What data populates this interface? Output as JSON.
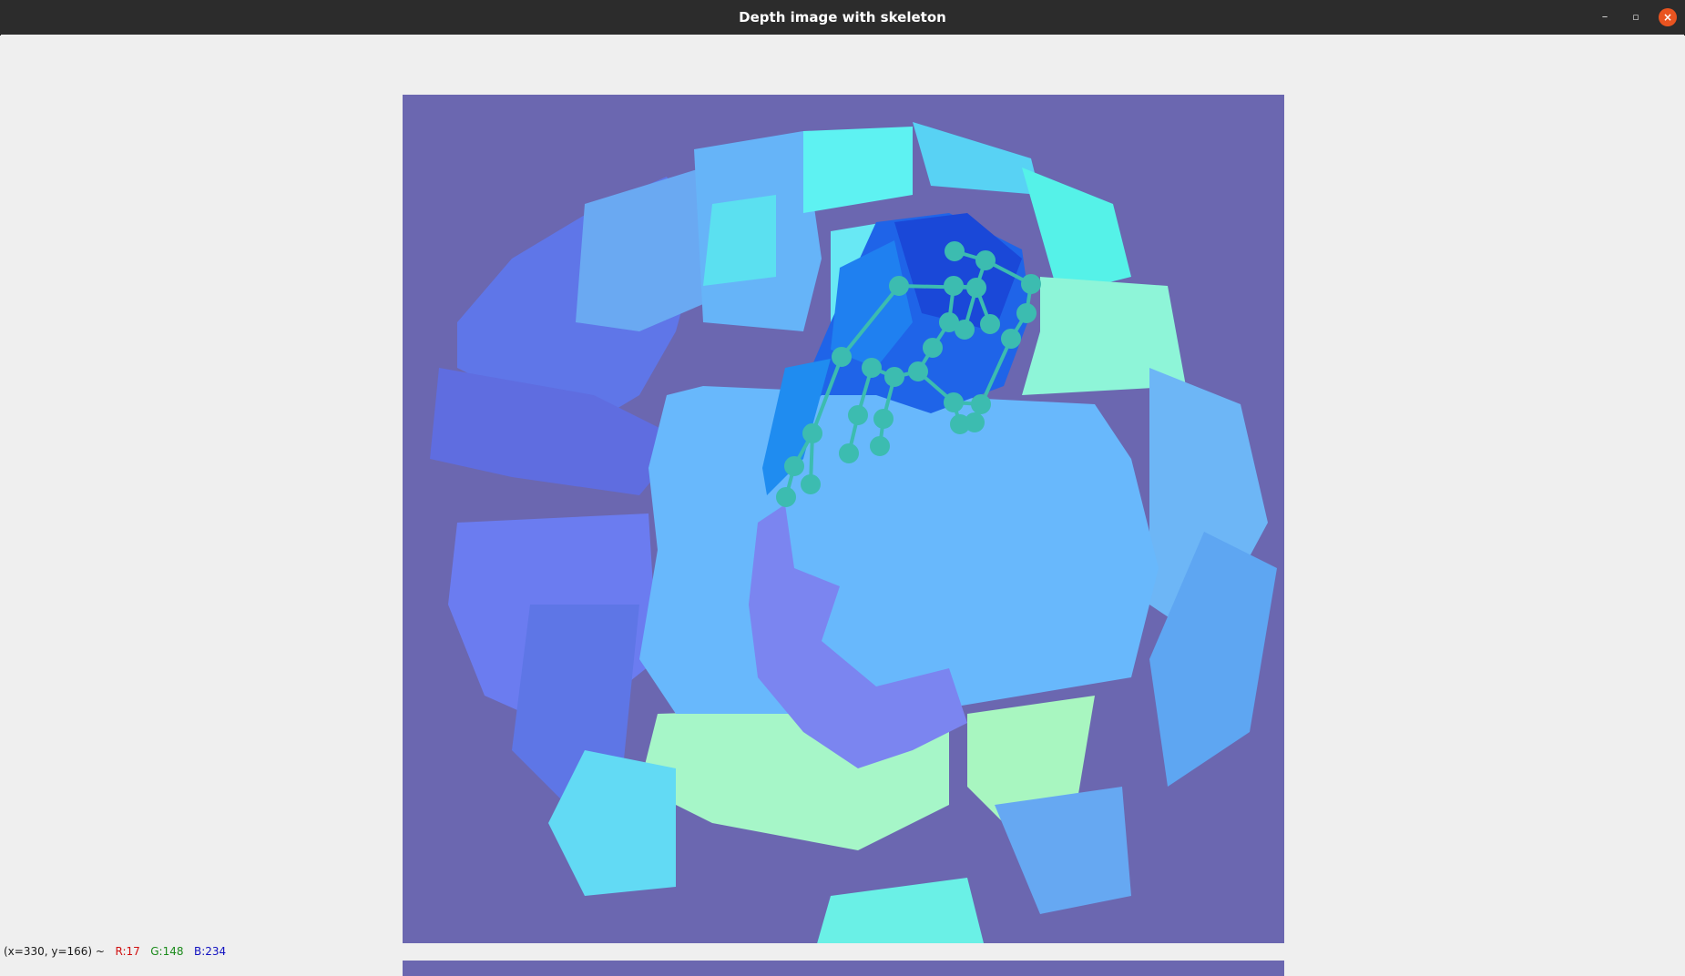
{
  "window": {
    "title": "Depth image with skeleton",
    "minimize_glyph": "–",
    "maximize_glyph": "▫",
    "close_glyph": "×"
  },
  "image": {
    "background_color": "#6b67b0",
    "skeleton_color": "#3cbcb0"
  },
  "status": {
    "coords": "(x=330, y=166) ~",
    "r": "R:17",
    "g": "G:148",
    "b": "B:234"
  },
  "icons": {
    "minimize": "minimize-icon",
    "maximize": "maximize-icon",
    "close": "close-icon"
  }
}
